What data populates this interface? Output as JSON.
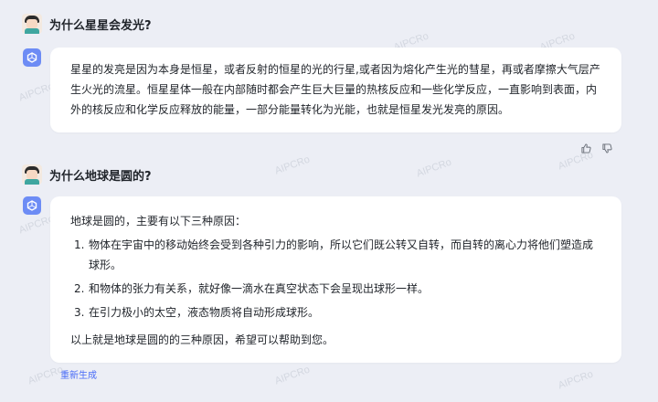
{
  "watermark_text": "AIPCRo",
  "conversation": [
    {
      "question": "为什么星星会发光?",
      "answer_paragraph": "星星的发亮是因为本身是恒星，或者反射的恒星的光的行星,或者因为熔化产生光的彗星，再或者摩擦大气层产生火光的流星。恒星星体一般在内部随时都会产生巨大巨量的热核反应和一些化学反应，一直影响到表面，内外的核反应和化学反应释放的能量，一部分能量转化为光能，也就是恒星发光发亮的原因。"
    },
    {
      "question": "为什么地球是圆的?",
      "intro": "地球是圆的，主要有以下三种原因：",
      "list": [
        {
          "num": "1.",
          "text": "物体在宇宙中的移动始终会受到各种引力的影响，所以它们既公转又自转，而自转的离心力将他们塑造成球形。"
        },
        {
          "num": "2.",
          "text": "和物体的张力有关系，就好像一滴水在真空状态下会呈现出球形一样。"
        },
        {
          "num": "3.",
          "text": "在引力极小的太空，液态物质将自动形成球形。"
        }
      ],
      "conclusion": "以上就是地球是圆的的三种原因，希望可以帮助到您。"
    }
  ],
  "regenerate_label": "重新生成",
  "colors": {
    "accent": "#4a6cf7",
    "bot_icon": "#6d8cf5",
    "background": "#eceef5"
  },
  "icons": [
    "bot-icon",
    "thumbs-up-icon",
    "thumbs-down-icon"
  ]
}
